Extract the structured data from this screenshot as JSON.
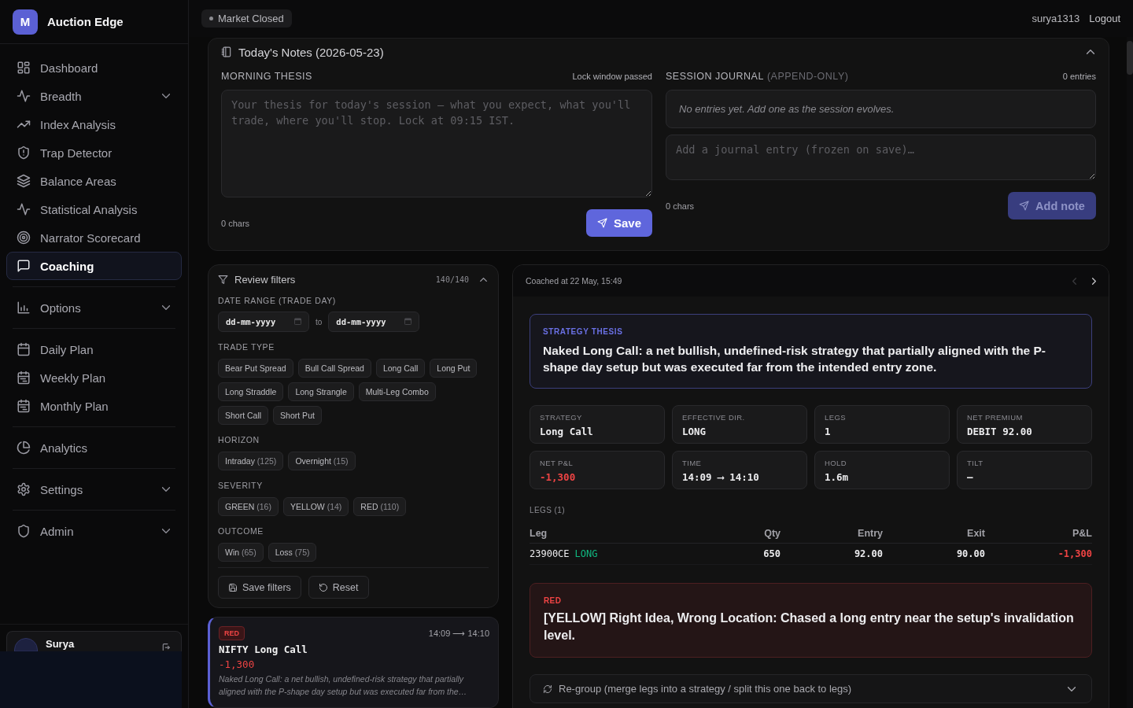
{
  "sidebar": {
    "brand": {
      "logo_letter": "M",
      "name": "Auction Edge"
    },
    "groups": [
      {
        "items": [
          {
            "label": "Dashboard",
            "kind": "link",
            "selected": false
          },
          {
            "label": "Breadth",
            "kind": "group",
            "expanded": false,
            "selected": false
          },
          {
            "label": "Index Analysis",
            "kind": "link",
            "selected": false
          },
          {
            "label": "Trap Detector",
            "kind": "link",
            "selected": false
          },
          {
            "label": "Balance Areas",
            "kind": "link",
            "selected": false
          },
          {
            "label": "Statistical Analysis",
            "kind": "link",
            "selected": false
          },
          {
            "label": "Narrator Scorecard",
            "kind": "link",
            "selected": false
          },
          {
            "label": "Coaching",
            "kind": "link",
            "selected": true
          }
        ]
      },
      {
        "items": [
          {
            "label": "Options",
            "kind": "group",
            "expanded": false,
            "selected": false
          }
        ]
      },
      {
        "items": [
          {
            "label": "Daily Plan",
            "kind": "link",
            "selected": false
          },
          {
            "label": "Weekly Plan",
            "kind": "link",
            "selected": false
          },
          {
            "label": "Monthly Plan",
            "kind": "link",
            "selected": false
          }
        ]
      },
      {
        "items": [
          {
            "label": "Analytics",
            "kind": "link",
            "selected": false
          }
        ]
      },
      {
        "items": [
          {
            "label": "Settings",
            "kind": "group",
            "expanded": false,
            "selected": false
          }
        ]
      },
      {
        "items": [
          {
            "label": "Admin",
            "kind": "group",
            "expanded": false,
            "selected": false
          }
        ]
      }
    ],
    "user": {
      "name": "Surya"
    }
  },
  "header": {
    "market_status": {
      "label": "Market Closed",
      "open": false
    },
    "username": "surya1313",
    "logout": "Logout"
  },
  "notes": {
    "title": "Today's Notes (2026-05-23)",
    "expanded": true,
    "morning_thesis": {
      "label": "MORNING THESIS",
      "lock_note": "Lock window passed",
      "placeholder": "Your thesis for today's session — what you expect, what you'll trade, where you'll stop. Lock at 09:15 IST.",
      "char_count": "0 chars",
      "save_button": {
        "label": "Save",
        "disabled": false
      }
    },
    "session_journal": {
      "label": "SESSION JOURNAL",
      "label_note": "(APPEND-ONLY)",
      "entry_count": "0 entries",
      "empty_message": "No entries yet. Add one as the session evolves.",
      "placeholder": "Add a journal entry (frozen on save)…",
      "char_count": "0 chars",
      "add_button": {
        "label": "Add note",
        "disabled": true
      }
    }
  },
  "filters": {
    "title": "Review filters",
    "count": "140/140",
    "expanded": true,
    "date_range": {
      "label": "DATE RANGE (TRADE DAY)",
      "from": {
        "placeholder": "dd-mm-yyyy"
      },
      "separator": "to",
      "to": {
        "placeholder": "dd-mm-yyyy"
      }
    },
    "sections": [
      {
        "label": "TRADE TYPE",
        "chips": [
          {
            "label": "Bear Put Spread",
            "selected": false
          },
          {
            "label": "Bull Call Spread",
            "selected": false
          },
          {
            "label": "Long Call",
            "selected": false
          },
          {
            "label": "Long Put",
            "selected": false
          },
          {
            "label": "Long Straddle",
            "selected": false
          },
          {
            "label": "Long Strangle",
            "selected": false
          },
          {
            "label": "Multi-Leg Combo",
            "selected": false
          },
          {
            "label": "Short Call",
            "selected": false
          },
          {
            "label": "Short Put",
            "selected": false
          }
        ]
      },
      {
        "label": "HORIZON",
        "chips": [
          {
            "label": "Intraday",
            "count": "(125)",
            "selected": false
          },
          {
            "label": "Overnight",
            "count": "(15)",
            "selected": false
          }
        ]
      },
      {
        "label": "SEVERITY",
        "chips": [
          {
            "label": "GREEN",
            "count": "(16)",
            "selected": false
          },
          {
            "label": "YELLOW",
            "count": "(14)",
            "selected": false
          },
          {
            "label": "RED",
            "count": "(110)",
            "selected": false
          }
        ]
      },
      {
        "label": "OUTCOME",
        "chips": [
          {
            "label": "Win",
            "count": "(65)",
            "selected": false
          },
          {
            "label": "Loss",
            "count": "(75)",
            "selected": false
          }
        ]
      }
    ],
    "buttons": [
      {
        "label": "Save filters"
      },
      {
        "label": "Reset"
      }
    ]
  },
  "trades": [
    {
      "severity": {
        "text": "RED",
        "kind": "red"
      },
      "time": "14:09 ⟶ 14:10",
      "title": "NIFTY Long Call",
      "pnl": {
        "text": "-1,300",
        "kind": "loss"
      },
      "summary": "Naked Long Call: a net bullish, undefined-risk strategy that partially aligned with the P-shape day setup but was executed far from the…",
      "selected": true
    }
  ],
  "coaching": {
    "coached_at": "Coached at 22 May, 15:49",
    "pager": {
      "prev_disabled": true,
      "next_disabled": false
    },
    "thesis": {
      "label": "STRATEGY THESIS",
      "text": "Naked Long Call: a net bullish, undefined-risk strategy that partially aligned with the P-shape day setup but was executed far from the intended entry zone."
    },
    "stats": [
      {
        "label": "STRATEGY",
        "value": "Long Call",
        "kind": "plain"
      },
      {
        "label": "EFFECTIVE DIR.",
        "value": "LONG",
        "kind": "plain"
      },
      {
        "label": "LEGS",
        "value": "1",
        "kind": "plain"
      },
      {
        "label": "NET PREMIUM",
        "value": "DEBIT 92.00",
        "kind": "plain"
      },
      {
        "label": "NET P&L",
        "value": "-1,300",
        "kind": "loss"
      },
      {
        "label": "TIME",
        "value": "14:09 ⟶ 14:10",
        "kind": "plain"
      },
      {
        "label": "HOLD",
        "value": "1.6m",
        "kind": "plain"
      },
      {
        "label": "TILT",
        "value": "—",
        "kind": "plain"
      }
    ],
    "legs": {
      "label": "LEGS (1)",
      "columns": [
        "Leg",
        "Qty",
        "Entry",
        "Exit",
        "P&L"
      ],
      "rows": [
        {
          "leg": "23900CE",
          "side": {
            "text": "LONG",
            "kind": "long"
          },
          "qty": "650",
          "entry": "92.00",
          "exit": "90.00",
          "pnl": {
            "text": "-1,300",
            "kind": "loss"
          }
        }
      ]
    },
    "verdict": {
      "label": "RED",
      "kind": "red",
      "text": "[YELLOW] Right Idea, Wrong Location: Chased a long entry near the setup's invalidation level."
    },
    "regroup": {
      "label": "Re-group (merge legs into a strategy / split this one back to legs)",
      "expanded": false
    }
  }
}
